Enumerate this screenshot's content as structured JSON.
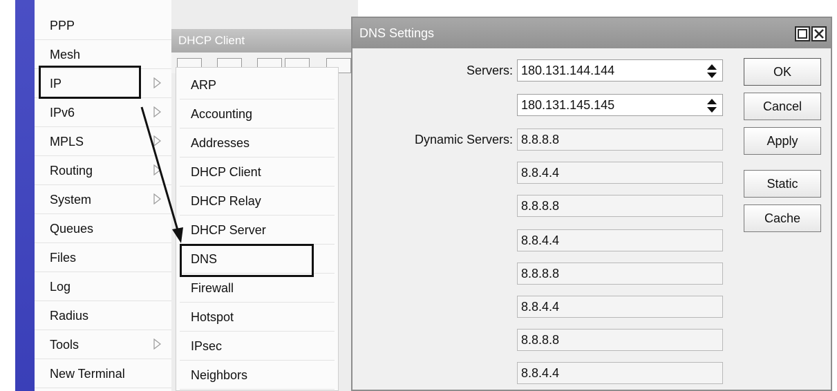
{
  "main_menu": {
    "items": [
      {
        "label": "PPP",
        "submenu": false
      },
      {
        "label": "Mesh",
        "submenu": false
      },
      {
        "label": "IP",
        "submenu": true
      },
      {
        "label": "IPv6",
        "submenu": true
      },
      {
        "label": "MPLS",
        "submenu": true
      },
      {
        "label": "Routing",
        "submenu": true
      },
      {
        "label": "System",
        "submenu": true
      },
      {
        "label": "Queues",
        "submenu": false
      },
      {
        "label": "Files",
        "submenu": false
      },
      {
        "label": "Log",
        "submenu": false
      },
      {
        "label": "Radius",
        "submenu": false
      },
      {
        "label": "Tools",
        "submenu": true
      },
      {
        "label": "New Terminal",
        "submenu": false
      }
    ]
  },
  "background_window": {
    "title": "DHCP Client"
  },
  "ip_submenu": {
    "items": [
      "ARP",
      "Accounting",
      "Addresses",
      "DHCP Client",
      "DHCP Relay",
      "DHCP Server",
      "DNS",
      "Firewall",
      "Hotspot",
      "IPsec",
      "Neighbors"
    ]
  },
  "dns_dialog": {
    "title": "DNS Settings",
    "servers_label": "Servers:",
    "servers": [
      "180.131.144.144",
      "180.131.145.145"
    ],
    "dynamic_servers_label": "Dynamic Servers:",
    "dynamic_servers": [
      "8.8.8.8",
      "8.8.4.4",
      "8.8.8.8",
      "8.8.4.4",
      "8.8.8.8",
      "8.8.4.4",
      "8.8.8.8",
      "8.8.4.4"
    ],
    "buttons": {
      "ok": "OK",
      "cancel": "Cancel",
      "apply": "Apply",
      "static": "Static",
      "cache": "Cache"
    }
  },
  "colors": {
    "sidebar_blue": "#3a3fb8",
    "titlebar_gray": "#9a9a9a",
    "highlight_border": "#111111"
  },
  "icons": {
    "submenu_arrow": "submenu-arrow-icon",
    "spinner": "updown-spinner-icon",
    "maximize": "maximize-icon",
    "close": "close-icon"
  }
}
